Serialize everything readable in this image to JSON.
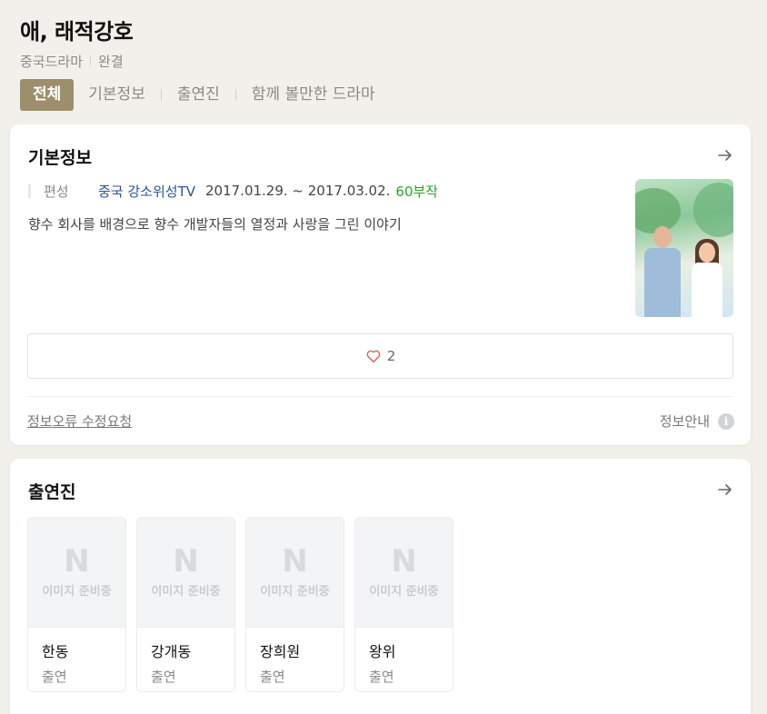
{
  "header": {
    "title": "애, 래적강호",
    "genre": "중국드라마",
    "status": "완결"
  },
  "tabs": [
    {
      "label": "전체",
      "active": true
    },
    {
      "label": "기본정보",
      "active": false
    },
    {
      "label": "출연진",
      "active": false
    },
    {
      "label": "함께 볼만한 드라마",
      "active": false
    }
  ],
  "basic_info": {
    "section_title": "기본정보",
    "label": "편성",
    "channel": "중국 강소위성TV",
    "date_range": "2017.01.29. ~ 2017.03.02.",
    "episodes": "60부작",
    "synopsis": "향수 회사를 배경으로 향수 개발자들의 열정과 사랑을 그린 이야기",
    "like_count": "2",
    "report_link": "정보오류 수정요청",
    "info_guide": "정보안내",
    "info_icon_glyph": "i"
  },
  "cast": {
    "section_title": "출연진",
    "placeholder_logo": "N",
    "placeholder_text": "이미지 준비중",
    "members": [
      {
        "name": "한동",
        "role": "출연"
      },
      {
        "name": "강개동",
        "role": "출연"
      },
      {
        "name": "장희원",
        "role": "출연"
      },
      {
        "name": "왕위",
        "role": "출연"
      }
    ]
  },
  "colors": {
    "background": "#f1f0ea",
    "active_tab": "#9d8f6c",
    "channel_link": "#2b5494",
    "episodes": "#29a629",
    "heart": "#e05a5a"
  },
  "icons": {
    "arrow": "arrow-right-icon",
    "heart": "heart-outline-icon",
    "info": "info-icon"
  }
}
